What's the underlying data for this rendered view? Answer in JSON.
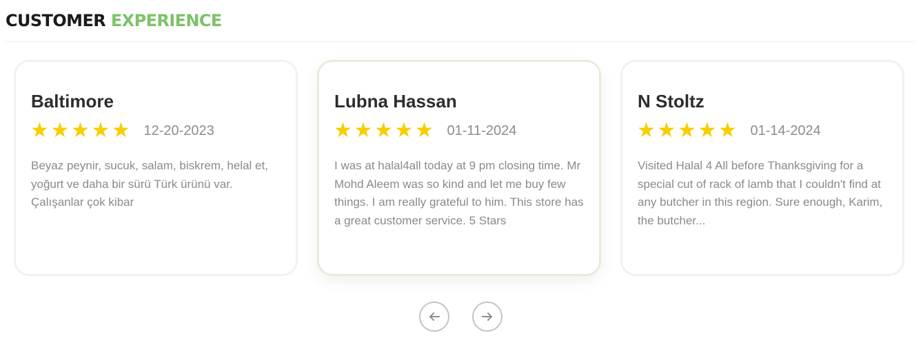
{
  "header": {
    "title_part1": "CUSTOMER",
    "title_part2": "EXPERIENCE",
    "accent_color": "#7dc26a"
  },
  "reviews": [
    {
      "name": "Baltimore",
      "rating": 5,
      "date": "12-20-2023",
      "text": "Beyaz peynir, sucuk, salam, biskrem, helal et, yoğurt ve daha bir sürü Türk ürünü var. Çalışanlar çok kibar"
    },
    {
      "name": "Lubna Hassan",
      "rating": 5,
      "date": "01-11-2024",
      "text": "I was at halal4all today at 9 pm closing time. Mr Mohd Aleem was so kind and let me buy few things. I am really grateful to him. This store has a great customer service. 5 Stars"
    },
    {
      "name": "N Stoltz",
      "rating": 5,
      "date": "01-14-2024",
      "text": "Visited Halal 4 All before Thanksgiving for a special cut of rack of lamb that I couldn't find at any butcher in this region. Sure enough, Karim, the butcher..."
    }
  ],
  "carousel": {
    "prev_icon": "arrow-left-icon",
    "next_icon": "arrow-right-icon"
  },
  "colors": {
    "star": "#f7ce00",
    "text_muted": "#8a8a8a"
  }
}
